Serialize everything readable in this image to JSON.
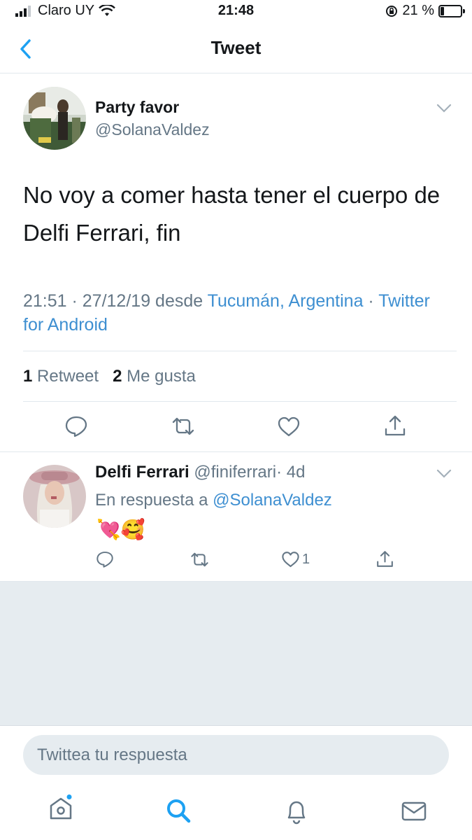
{
  "status_bar": {
    "carrier": "Claro UY",
    "time": "21:48",
    "battery_percent": "21 %",
    "battery_level": 0.21
  },
  "header": {
    "title": "Tweet",
    "back_icon": "chevron-left-icon"
  },
  "tweet": {
    "display_name": "Party favor",
    "handle": "@SolanaValdez",
    "text": "No voy a comer hasta tener el cuerpo de Delfi Ferrari, fin",
    "meta_time": "21:51 · 27/12/19 desde ",
    "meta_location": "Tucumán, Argentina",
    "meta_sep": " · ",
    "meta_source": "Twitter for Android",
    "retweets_count": "1",
    "retweets_label": "Retweet",
    "likes_count": "2",
    "likes_label": "Me gusta"
  },
  "reply": {
    "display_name": "Delfi Ferrari",
    "handle": "@finiferrari",
    "age": "· 4d",
    "in_reply_prefix": "En respuesta a ",
    "in_reply_handle": "@SolanaValdez",
    "emoji": "💘🥰",
    "likes_count": "1"
  },
  "composer": {
    "placeholder": "Twittea tu respuesta"
  },
  "tabs": [
    "home-icon",
    "search-icon",
    "notifications-icon",
    "messages-icon"
  ],
  "colors": {
    "accent": "#1da1f2",
    "link": "#3e8fd1",
    "secondary_text": "#657786",
    "divider": "#e1e8ed",
    "gray_area": "#e6ecf0"
  }
}
